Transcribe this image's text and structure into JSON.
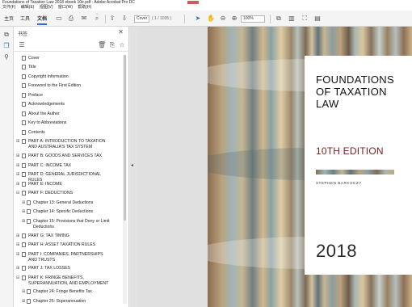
{
  "window": {
    "title": "Foundations of Taxation Law 2018 ebook 10e.pdf - Adobe Acrobat Pro DC"
  },
  "menu": [
    "文件(F)",
    "编辑(E)",
    "视图(V)",
    "窗口(W)",
    "帮助(H)"
  ],
  "tabs": [
    {
      "label": "主页"
    },
    {
      "label": "工具"
    },
    {
      "label": "文档"
    }
  ],
  "toolbar": {
    "page_field": "Cover",
    "page_count": "( 1 / 1035 )",
    "zoom": "100%"
  },
  "panel": {
    "title": "书签",
    "bookmarks": [
      {
        "label": "Cover",
        "expandable": false
      },
      {
        "label": "Title",
        "expandable": false
      },
      {
        "label": "Copyright Information",
        "expandable": false
      },
      {
        "label": "Foreword to the First Edition",
        "expandable": false
      },
      {
        "label": "Preface",
        "expandable": false
      },
      {
        "label": "Acknowledgements",
        "expandable": false
      },
      {
        "label": "About the Author",
        "expandable": false
      },
      {
        "label": "Key to Abbreviations",
        "expandable": false
      },
      {
        "label": "Contents",
        "expandable": false
      },
      {
        "label": "PART A: INTRODUCTION TO TAXATION AND AUSTRALIA'S TAX SYSTEM",
        "expandable": true
      },
      {
        "label": "PART B: GOODS AND SERVICES TAX",
        "expandable": true
      },
      {
        "label": "PART C: INCOME TAX",
        "expandable": true
      },
      {
        "label": "PART D: GENERAL JURISDICTIONAL RULES",
        "expandable": true
      },
      {
        "label": "PART E: INCOME",
        "expandable": true
      },
      {
        "label": "PART F: DEDUCTIONS",
        "expandable": true,
        "expanded": true
      },
      {
        "label": "Chapter 13: General Deductions",
        "expandable": true,
        "child": true
      },
      {
        "label": "Chapter 14: Specific Deductions",
        "expandable": true,
        "child": true
      },
      {
        "label": "Chapter 15: Provisions that Deny or Limit Deductions",
        "expandable": true,
        "child": true
      },
      {
        "label": "PART G: TAX TIMING",
        "expandable": true
      },
      {
        "label": "PART H: ASSET TAXATION RULES",
        "expandable": true
      },
      {
        "label": "PART I: COMPANIES, PARTNERSHIPS AND TRUSTS",
        "expandable": true
      },
      {
        "label": "PART J: TAX LOSSES",
        "expandable": true
      },
      {
        "label": "PART K: FRINGE BENEFITS, SUPERANNUATION, AND EMPLOYMENT",
        "expandable": true,
        "expanded": true
      },
      {
        "label": "Chapter 24: Fringe Benefits Tax",
        "expandable": true,
        "child": true
      },
      {
        "label": "Chapter 25: Superannuation",
        "expandable": true,
        "child": true
      }
    ]
  },
  "cover": {
    "title": "FOUNDATIONS OF TAXATION LAW",
    "edition": "10TH EDITION",
    "author": "STEPHEN BARKOCZY",
    "year": "2018"
  }
}
